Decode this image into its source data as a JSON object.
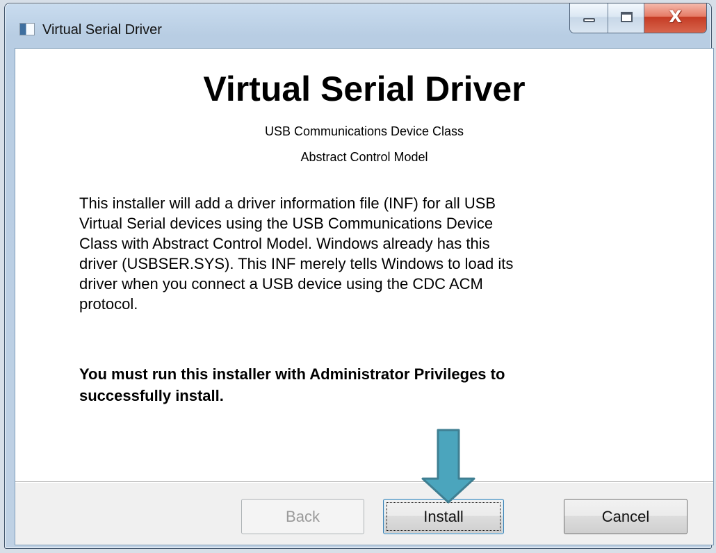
{
  "window": {
    "title": "Virtual Serial Driver",
    "close_symbol": "X"
  },
  "icons": {
    "app": "application-icon",
    "minimize": "minimize-icon",
    "maximize": "maximize-icon",
    "close": "close-icon",
    "callout": "down-arrow-icon"
  },
  "content": {
    "heading": "Virtual Serial Driver",
    "subtitle_lines": [
      "USB Communications Device Class",
      "Abstract Control Model"
    ],
    "description_lines": [
      "This installer will add a driver information file (INF) for all USB",
      "Virtual Serial devices using the USB Communications Device",
      "Class with Abstract Control Model.  Windows already has this",
      "driver (USBSER.SYS).  This INF merely tells Windows to load its",
      "driver when you connect a USB device using the CDC ACM",
      "protocol."
    ],
    "warning_lines": [
      "You must run this installer with Administrator Privileges to",
      "successfully install."
    ]
  },
  "buttons": {
    "back": "Back",
    "install": "Install",
    "cancel": "Cancel"
  },
  "colors": {
    "callout_arrow": "#4ba5bd",
    "callout_border": "#3f7f92"
  }
}
